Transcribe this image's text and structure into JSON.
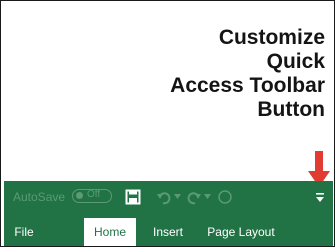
{
  "callout": {
    "lines": [
      "Customize",
      "Quick",
      "Access Toolbar",
      "Button"
    ]
  },
  "qat": {
    "autosave_label": "AutoSave",
    "autosave_state": "Off",
    "icons": [
      "save-icon",
      "undo-icon",
      "redo-icon",
      "touch-mode-icon",
      "customize-qat-icon"
    ]
  },
  "tabs": [
    "File",
    "Home",
    "Insert",
    "Page Layout"
  ],
  "active_tab": "Home",
  "colors": {
    "ribbon": "#217346",
    "arrow": "#e03c31",
    "dim_text": "#5a9a75"
  }
}
